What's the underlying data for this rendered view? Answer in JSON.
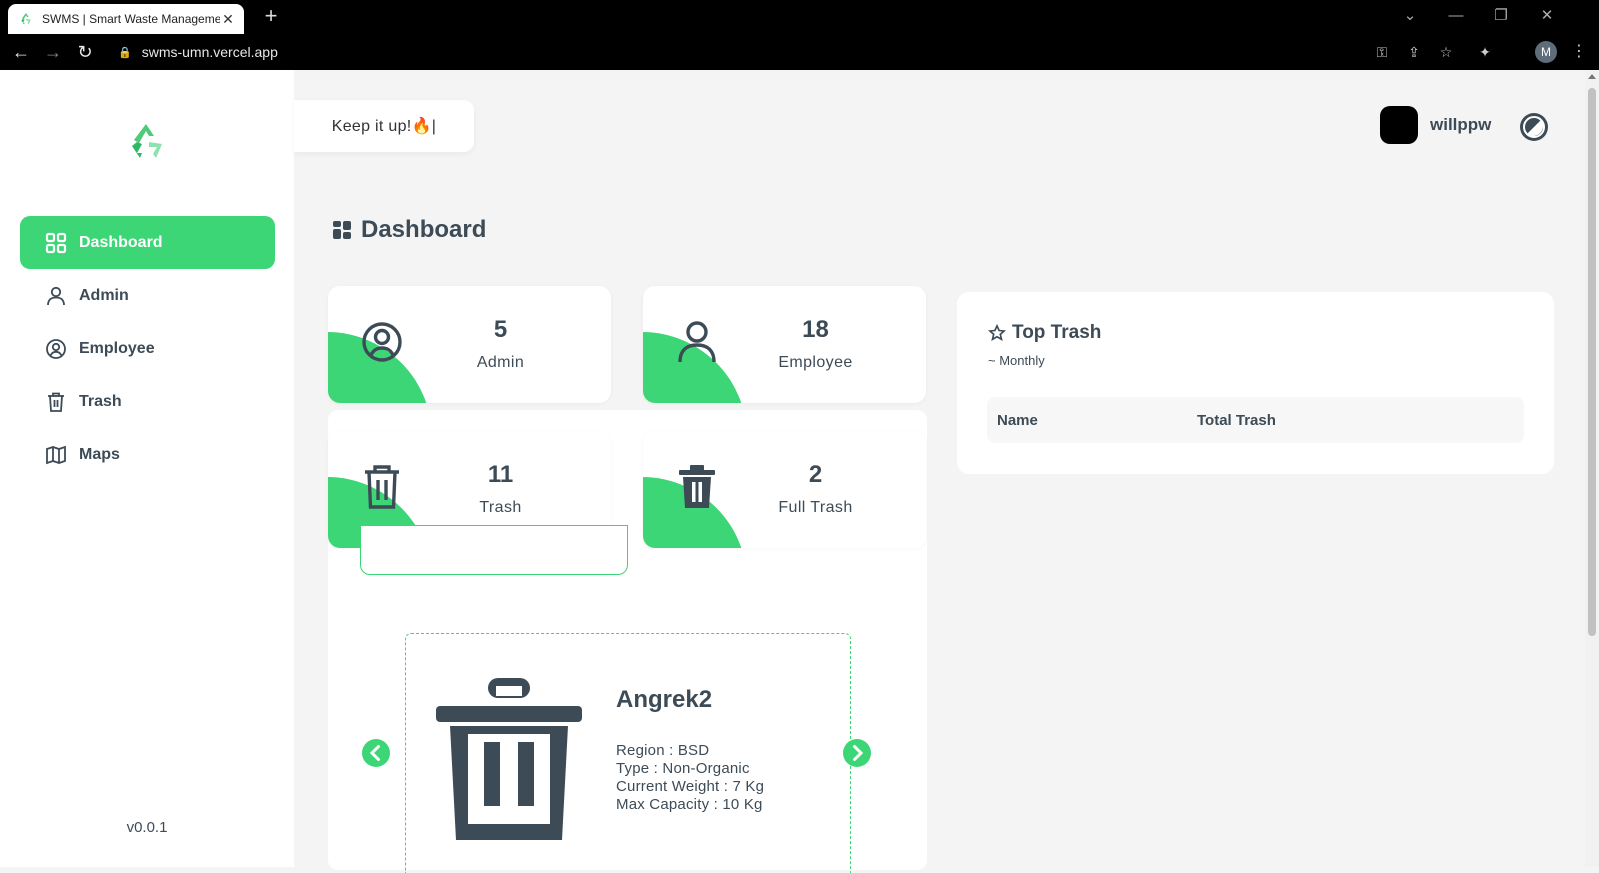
{
  "browser": {
    "tab_title": "SWMS | Smart Waste Manageme",
    "tab_close": "✕",
    "new_tab": "+",
    "url": "swms-umn.vercel.app",
    "profile_initial": "M"
  },
  "header": {
    "toast_text": "Keep it up!🔥|",
    "username": "willppw"
  },
  "sidebar": {
    "items": [
      {
        "label": "Dashboard",
        "icon": "dashboard-grid-icon",
        "active": true
      },
      {
        "label": "Admin",
        "icon": "user-icon"
      },
      {
        "label": "Employee",
        "icon": "user-circle-icon"
      },
      {
        "label": "Trash",
        "icon": "trash-icon"
      },
      {
        "label": "Maps",
        "icon": "map-icon"
      }
    ],
    "version": "v0.0.1"
  },
  "page_title": "Dashboard",
  "stats": [
    {
      "value": "5",
      "label": "Admin",
      "icon": "user-circle-icon"
    },
    {
      "value": "18",
      "label": "Employee",
      "icon": "user-icon"
    },
    {
      "value": "11",
      "label": "Trash",
      "icon": "trash-icon"
    },
    {
      "value": "2",
      "label": "Full Trash",
      "icon": "trash-full-icon"
    }
  ],
  "trash_card": {
    "name": "Angrek2",
    "region": "Region : BSD",
    "type": "Type : Non-Organic",
    "weight": "Current Weight : 7 Kg",
    "capacity": "Max Capacity : 10 Kg"
  },
  "top_trash": {
    "title": "Top Trash",
    "subtitle": "~ Monthly",
    "columns": [
      "Name",
      "Total Trash"
    ]
  },
  "colors": {
    "accent": "#3dd676",
    "text": "#3d4b57",
    "background": "#f4f4f4"
  }
}
